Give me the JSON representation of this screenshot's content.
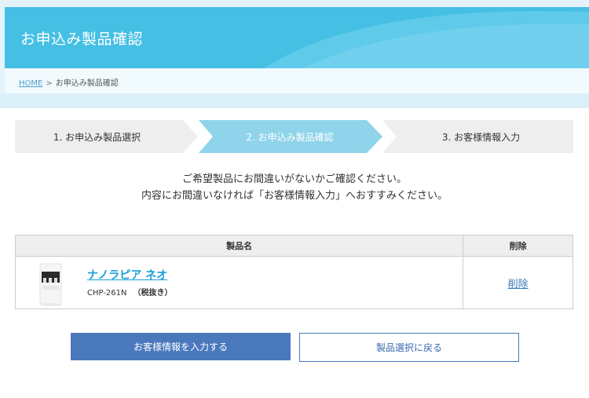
{
  "header": {
    "title": "お申込み製品確認"
  },
  "breadcrumb": {
    "home": "HOME",
    "separator": ">",
    "current": "お申込み製品確認"
  },
  "steps": [
    {
      "label": "1. お申込み製品選択",
      "active": false
    },
    {
      "label": "2. お申込み製品確認",
      "active": true
    },
    {
      "label": "3. お客様情報入力",
      "active": false
    }
  ],
  "message": {
    "line1": "ご希望製品にお間違いがないかご確認ください。",
    "line2": "内容にお間違いなければ「お客様情報入力」へおすすみください。"
  },
  "table": {
    "headers": {
      "name": "製品名",
      "delete": "削除"
    },
    "rows": [
      {
        "image_icon": "water-server-icon",
        "name": "ナノラピア ネオ",
        "code": "CHP-261N",
        "tax_note": "（税抜き）",
        "delete_label": "削除"
      }
    ]
  },
  "buttons": {
    "proceed": "お客様情報を入力する",
    "back": "製品選択に戻る"
  },
  "colors": {
    "header_bg": "#45bfe4",
    "active_step": "#8fd4ea",
    "primary_button": "#4a78bd",
    "link": "#1b9ed8"
  }
}
